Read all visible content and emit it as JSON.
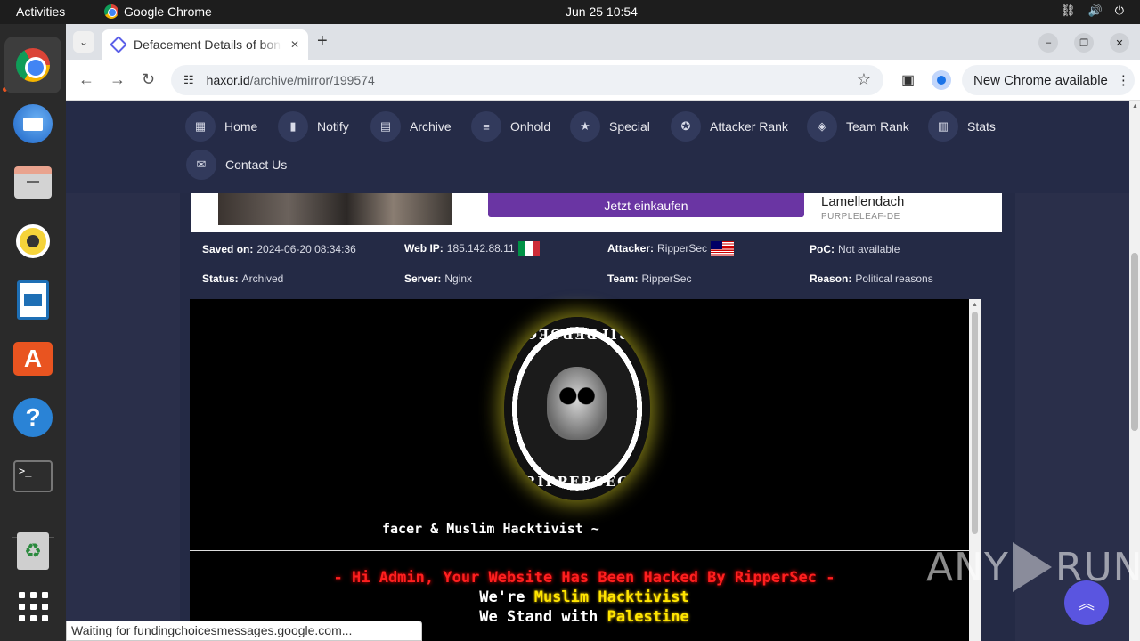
{
  "desktop": {
    "activities": "Activities",
    "app_name": "Google Chrome",
    "clock": "Jun 25  10:54",
    "tray_icons": [
      "network-icon",
      "volume-icon",
      "power-icon"
    ]
  },
  "dock": {
    "items": [
      "Google Chrome",
      "Thunderbird Mail",
      "Files",
      "Rhythmbox",
      "LibreOffice Writer",
      "Ubuntu Software",
      "Help",
      "Terminal",
      "Trash",
      "Show Applications"
    ]
  },
  "browser": {
    "tab_title": "Defacement Details of bondahub.com",
    "url_host": "haxor.id",
    "url_path": "/archive/mirror/199574",
    "update_label": "New Chrome available",
    "status_text": "Waiting for fundingchoicesmessages.google.com..."
  },
  "site": {
    "nav": [
      {
        "label": "Home",
        "icon": "dashboard-icon"
      },
      {
        "label": "Notify",
        "icon": "bookmark-icon"
      },
      {
        "label": "Archive",
        "icon": "archive-icon"
      },
      {
        "label": "Onhold",
        "icon": "document-icon"
      },
      {
        "label": "Special",
        "icon": "shield-star-icon"
      },
      {
        "label": "Attacker Rank",
        "icon": "award-icon"
      },
      {
        "label": "Team Rank",
        "icon": "layers-icon"
      },
      {
        "label": "Stats",
        "icon": "bar-chart-icon"
      },
      {
        "label": "Contact Us",
        "icon": "mail-icon"
      }
    ],
    "ad": {
      "button": "Jetzt einkaufen",
      "title": "Lamellendach",
      "sponsor": "PURPLELEAF-DE"
    },
    "details": {
      "saved_label": "Saved on:",
      "saved_value": "2024-06-20 08:34:36",
      "ip_label": "Web IP:",
      "ip_value": "185.142.88.11",
      "attacker_label": "Attacker:",
      "attacker_value": "RipperSec",
      "poc_label": "PoC:",
      "poc_value": "Not available",
      "status_label": "Status:",
      "status_value": "Archived",
      "server_label": "Server:",
      "server_value": "Nginx",
      "team_label": "Team:",
      "team_value": "RipperSec",
      "reason_label": "Reason:",
      "reason_value": "Political reasons"
    },
    "mirror": {
      "logo_text": "RIPPERSEC",
      "tagline": "facer & Muslim Hacktivist ~",
      "line1_dash_left": "- ",
      "line1_hi": "Hi Admin,",
      "line1_rest": " Your Website Has Been Hacked By RipperSec",
      "line1_dash_right": " -",
      "line2_pre": "We're ",
      "line2_hl": "Muslim Hacktivist",
      "line3_pre": "We Stand with ",
      "line3_hl": "Palestine"
    },
    "watermark_left": "ANY",
    "watermark_right": "RUN"
  }
}
